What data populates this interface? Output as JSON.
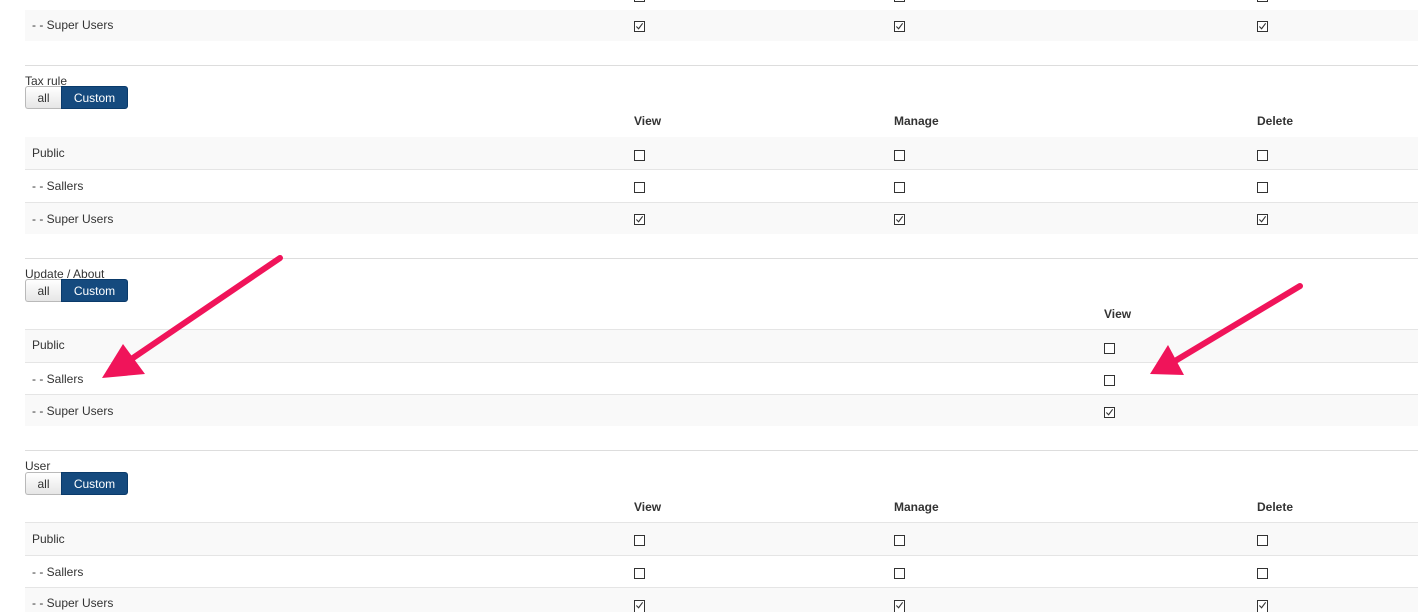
{
  "columns": {
    "view": "View",
    "manage": "Manage",
    "delete": "Delete"
  },
  "toggle": {
    "all": "all",
    "custom": "Custom"
  },
  "groups": {
    "public": "Public",
    "sallers": "- - Sallers",
    "super_users": "- - Super Users"
  },
  "sections": [
    {
      "title": "",
      "rows": [
        {
          "view": true,
          "manage": true,
          "delete": true
        }
      ]
    },
    {
      "title": "Tax rule",
      "rows": [
        {
          "view": false,
          "manage": false,
          "delete": false
        },
        {
          "view": false,
          "manage": false,
          "delete": false
        },
        {
          "view": true,
          "manage": true,
          "delete": true
        }
      ]
    },
    {
      "title": "Update / About",
      "rows": [
        {
          "view": false
        },
        {
          "view": false
        },
        {
          "view": true
        }
      ]
    },
    {
      "title": "User",
      "rows": [
        {
          "view": false,
          "manage": false,
          "delete": false
        },
        {
          "view": false,
          "manage": false,
          "delete": false
        },
        {
          "view": true,
          "manage": true,
          "delete": true
        }
      ]
    }
  ],
  "annotation_color": "#f0145a"
}
